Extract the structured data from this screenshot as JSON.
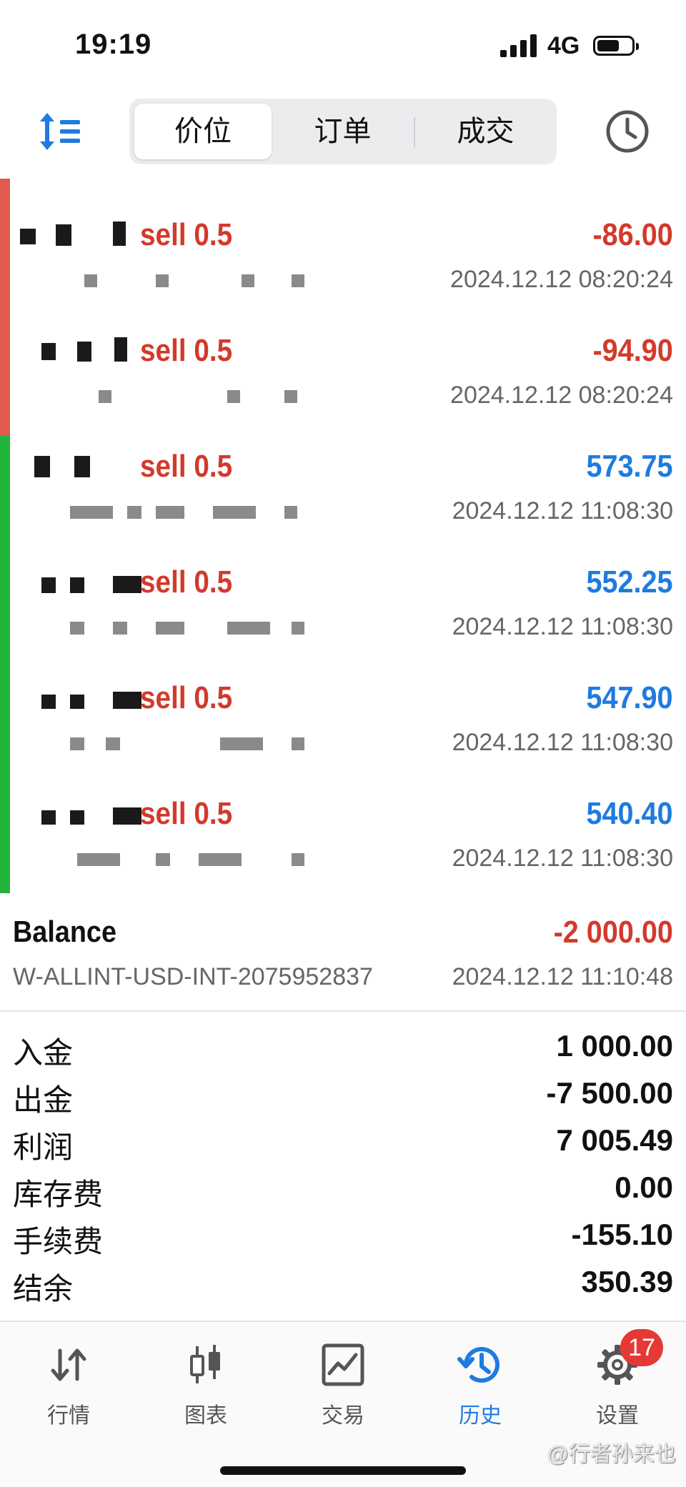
{
  "status_bar": {
    "time": "19:19",
    "network": "4G"
  },
  "toolbar": {
    "tabs": [
      {
        "label": "价位",
        "active": true
      },
      {
        "label": "订单",
        "active": false
      },
      {
        "label": "成交",
        "active": false
      }
    ]
  },
  "trades": [
    {
      "type": "sell 0.5",
      "profit": "-86.00",
      "time": "2024.12.12 08:20:24",
      "sign": "negative"
    },
    {
      "type": "sell 0.5",
      "profit": "-94.90",
      "time": "2024.12.12 08:20:24",
      "sign": "negative"
    },
    {
      "type": "sell 0.5",
      "profit": "573.75",
      "time": "2024.12.12 11:08:30",
      "sign": "positive"
    },
    {
      "type": "sell 0.5",
      "profit": "552.25",
      "time": "2024.12.12 11:08:30",
      "sign": "positive"
    },
    {
      "type": "sell 0.5",
      "profit": "547.90",
      "time": "2024.12.12 11:08:30",
      "sign": "positive"
    },
    {
      "type": "sell 0.5",
      "profit": "540.40",
      "time": "2024.12.12 11:08:30",
      "sign": "positive"
    }
  ],
  "balance": {
    "label": "Balance",
    "value": "-2 000.00",
    "id": "W-ALLINT-USD-INT-2075952837",
    "time": "2024.12.12 11:10:48"
  },
  "summary": [
    {
      "label": "入金",
      "value": "1 000.00"
    },
    {
      "label": "出金",
      "value": "-7 500.00"
    },
    {
      "label": "利润",
      "value": "7 005.49"
    },
    {
      "label": "库存费",
      "value": "0.00"
    },
    {
      "label": "手续费",
      "value": "-155.10"
    },
    {
      "label": "结余",
      "value": "350.39"
    }
  ],
  "tabbar": {
    "items": [
      {
        "label": "行情",
        "icon": "quotes-arrows-icon",
        "active": false
      },
      {
        "label": "图表",
        "icon": "candlestick-icon",
        "active": false
      },
      {
        "label": "交易",
        "icon": "trade-chart-icon",
        "active": false
      },
      {
        "label": "历史",
        "icon": "history-clock-icon",
        "active": true
      },
      {
        "label": "设置",
        "icon": "gear-icon",
        "active": false
      }
    ],
    "settings_badge": "17"
  },
  "watermark": "@行者孙来也",
  "colors": {
    "negative": "#d23a2c",
    "positive": "#1e7be0",
    "accent": "#1e7be0",
    "edge_red": "#e05a4e",
    "edge_green": "#22b33a"
  }
}
